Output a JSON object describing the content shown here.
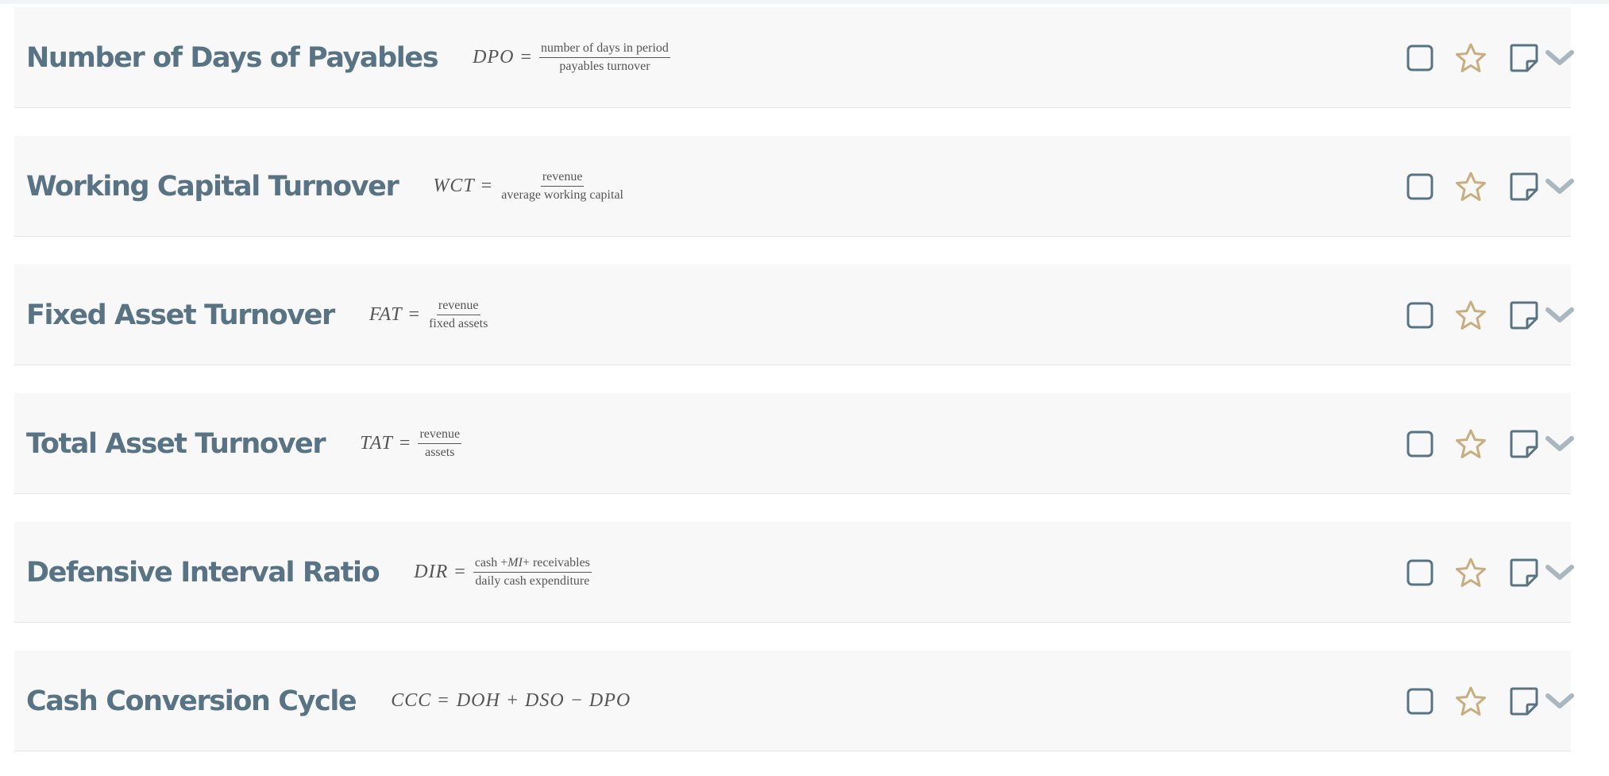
{
  "colors": {
    "title": "#587383",
    "card_bg": "#f8f8f8",
    "checkbox": "#587383",
    "star": "#c8ad7f",
    "note": "#587383",
    "chevron": "#a9b7c1"
  },
  "icons": {
    "checkbox": "checkbox-icon",
    "favorite": "star-icon",
    "note": "note-icon",
    "expand": "chevron-down-icon"
  },
  "cards": [
    {
      "title": "Number of Days of Payables",
      "lhs": "DPO",
      "eq": "=",
      "numerator": "number of days in period",
      "denominator": "payables turnover"
    },
    {
      "title": "Working Capital Turnover",
      "lhs": "WCT",
      "eq": "=",
      "numerator": "revenue",
      "denominator": "average working capital"
    },
    {
      "title": "Fixed Asset Turnover",
      "lhs": "FAT",
      "eq": "=",
      "numerator": "revenue",
      "denominator": "fixed assets"
    },
    {
      "title": "Total Asset Turnover",
      "lhs": "TAT",
      "eq": "=",
      "numerator": "revenue",
      "denominator": "assets"
    },
    {
      "title": "Defensive Interval Ratio",
      "lhs": "DIR",
      "eq": "=",
      "numerator_parts": [
        "cash +",
        "MI",
        "+ receivables"
      ],
      "denominator": "daily cash expenditure"
    },
    {
      "title": "Cash Conversion Cycle",
      "lhs": "CCC",
      "eq": "=",
      "rhs": "DOH + DSO − DPO"
    }
  ]
}
